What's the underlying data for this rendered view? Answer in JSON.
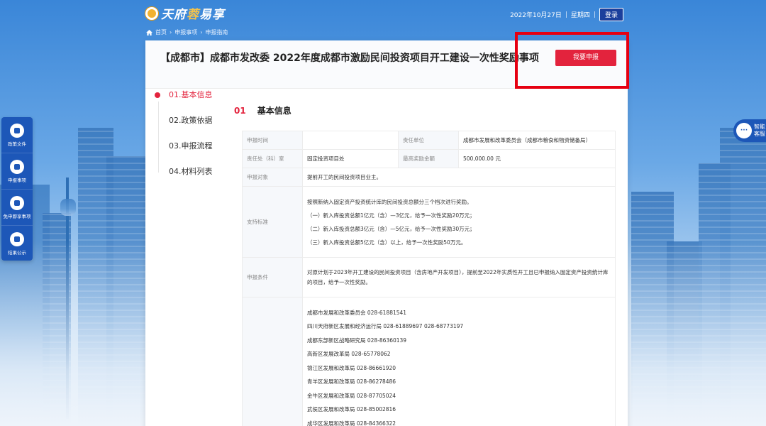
{
  "header": {
    "logo_text_a": "天府",
    "logo_text_b": "蓉",
    "logo_text_c": "易享",
    "date": "2022年10月27日",
    "weekday": "星期四",
    "login_label": "登录"
  },
  "breadcrumb": [
    "首页",
    "申报事项",
    "申报指南"
  ],
  "card": {
    "title": "【成都市】成都市发改委 2022年度成都市激励民间投资项目开工建设一次性奖励事项",
    "apply_label": "我要申报"
  },
  "nav": [
    "01.基本信息",
    "02.政策依据",
    "03.申报流程",
    "04.材料列表"
  ],
  "section": {
    "num": "01",
    "title": "基本信息"
  },
  "table": {
    "r1": {
      "label_a": "申报时间",
      "value_a": "",
      "label_b": "责任单位",
      "value_b": "成都市发展和改革委员会（成都市粮食和物资储备局）"
    },
    "r2": {
      "label_a": "责任处（科）室",
      "value_a": "固定投资项目处",
      "label_b": "最高奖励金额",
      "value_b": "500,000.00 元"
    },
    "r3": {
      "label": "申报对象",
      "value": "提前开工的民间投资项目业主。"
    },
    "r4": {
      "label": "支持标准",
      "lines": [
        "按照新纳入固定资产投资统计库的民间投资总额分三个档次进行奖励。",
        "（一）新入库投资总额1亿元（含）—3亿元，给予一次性奖励20万元；",
        "（二）新入库投资总额3亿元（含）—5亿元，给予一次性奖励30万元；",
        "（三）新入库投资总额5亿元（含）以上，给予一次性奖励50万元。"
      ]
    },
    "r5": {
      "label": "申报条件",
      "value": "对原计划于2023年开工建设的民间投资项目（含房地产开发项目），提前至2022年实质性开工且已申报纳入固定资产投资统计库的项目，给予一次性奖励。"
    },
    "r6": {
      "label": "",
      "contacts": [
        "成都市发展和改革委员会  028-61881541",
        "四川天府新区发展和经济运行局  028-61889697  028-68773197",
        "成都东部新区战略研究局  028-86360139",
        "高新区发展改革局  028-65778062",
        "锦江区发展和改革局  028-86661920",
        "青羊区发展和改革局  028-86278486",
        "金牛区发展和改革局  028-87705024",
        "武侯区发展和改革局  028-85002816",
        "成华区发展和改革局  028-84366322"
      ]
    }
  },
  "sidebar": [
    "政策文件",
    "申报事项",
    "免申即享事项",
    "结果公示"
  ],
  "service": {
    "line1": "智能",
    "line2": "客服"
  },
  "colors": {
    "accent": "#e3233d",
    "brand_blue": "#1d57b8",
    "highlight": "#e60012"
  }
}
